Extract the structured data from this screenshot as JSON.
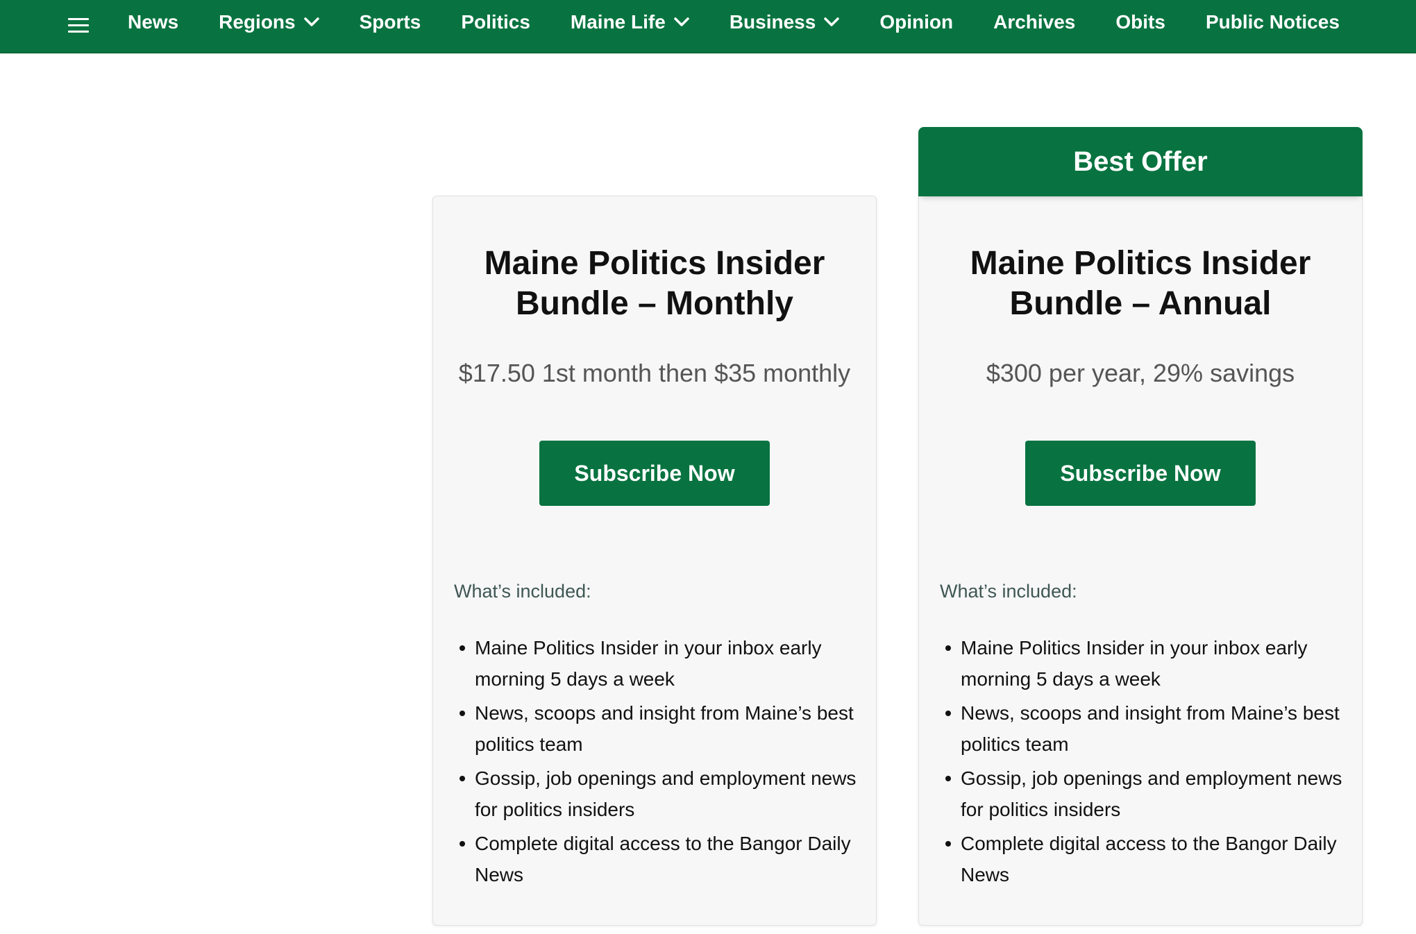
{
  "nav": {
    "items": [
      {
        "label": "News",
        "has_dropdown": false
      },
      {
        "label": "Regions",
        "has_dropdown": true
      },
      {
        "label": "Sports",
        "has_dropdown": false
      },
      {
        "label": "Politics",
        "has_dropdown": false
      },
      {
        "label": "Maine Life",
        "has_dropdown": true
      },
      {
        "label": "Business",
        "has_dropdown": true
      },
      {
        "label": "Opinion",
        "has_dropdown": false
      },
      {
        "label": "Archives",
        "has_dropdown": false
      },
      {
        "label": "Obits",
        "has_dropdown": false
      },
      {
        "label": "Public Notices",
        "has_dropdown": false
      }
    ],
    "menu_icon": "hamburger-menu-icon",
    "chevron_icon": "chevron-down-icon"
  },
  "plans": {
    "badge": "Best Offer",
    "monthly": {
      "title_line1": "Maine Politics Insider",
      "title_line2": "Bundle – Monthly",
      "price": "$17.50 1st month then $35 monthly",
      "cta": "Subscribe Now",
      "included_heading": "What’s included:",
      "features": [
        "Maine Politics Insider in your inbox early morning 5 days a week",
        "News, scoops and insight from Maine’s best politics team",
        "Gossip, job openings and employment news for politics insiders",
        "Complete digital access to the Bangor Daily News"
      ]
    },
    "annual": {
      "title_line1": "Maine Politics Insider",
      "title_line2": "Bundle – Annual",
      "price": "$300 per year, 29% savings",
      "cta": "Subscribe Now",
      "included_heading": "What’s included:",
      "features": [
        "Maine Politics Insider in your inbox early morning 5 days a week",
        "News, scoops and insight from Maine’s best politics team",
        "Gossip, job openings and employment news for politics insiders",
        "Complete digital access to the Bangor Daily News"
      ]
    }
  },
  "colors": {
    "brand_green": "#087340",
    "card_bg": "#f7f7f7",
    "price_text": "#555555",
    "included_text": "#3f5754"
  }
}
